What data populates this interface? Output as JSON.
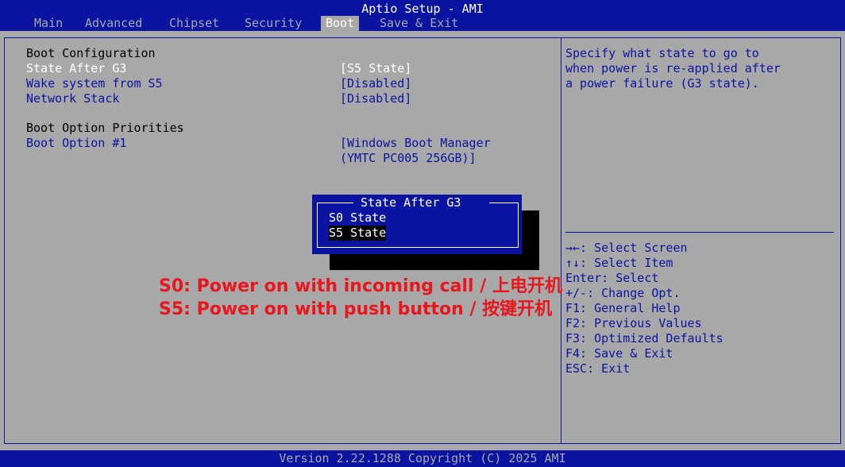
{
  "header": {
    "title": "Aptio Setup - AMI"
  },
  "tabs": [
    {
      "label": "Main"
    },
    {
      "label": "Advanced"
    },
    {
      "label": "Chipset"
    },
    {
      "label": "Security"
    },
    {
      "label": "Boot"
    },
    {
      "label": "Save & Exit"
    }
  ],
  "main": {
    "section1": "Boot Configuration",
    "items": [
      {
        "label": "State After G3",
        "value": "[S5 State]"
      },
      {
        "label": "Wake system from S5",
        "value": "[Disabled]"
      },
      {
        "label": "Network Stack",
        "value": "[Disabled]"
      }
    ],
    "section2": "Boot Option Priorities",
    "boot_option": {
      "label": "Boot Option #1",
      "value_line1": "[Windows Boot Manager",
      "value_line2": "(YMTC PC005 256GB)]"
    }
  },
  "popup": {
    "title": "State After G3",
    "options": [
      {
        "label": "S0 State",
        "selected": false
      },
      {
        "label": "S5 State",
        "selected": true
      }
    ]
  },
  "annotation": {
    "line1": "S0: Power on with incoming call / 上电开机",
    "line2": "S5: Power on with push button / 按键开机"
  },
  "help": {
    "description": [
      "Specify what state to go to",
      "when power is re-applied after",
      "a power failure (G3 state)."
    ],
    "keys": [
      "→←: Select Screen",
      "↑↓: Select Item",
      "Enter: Select",
      "+/-: Change Opt.",
      "F1: General Help",
      "F2: Previous Values",
      "F3: Optimized Defaults",
      "F4: Save & Exit",
      "ESC: Exit"
    ]
  },
  "footer": {
    "text": "Version 2.22.1288 Copyright (C) 2025 AMI"
  },
  "colors": {
    "bg": "#a8a8a8",
    "blue": "#0a14a0",
    "white": "#ffffff",
    "annotation": "#e8161d"
  }
}
